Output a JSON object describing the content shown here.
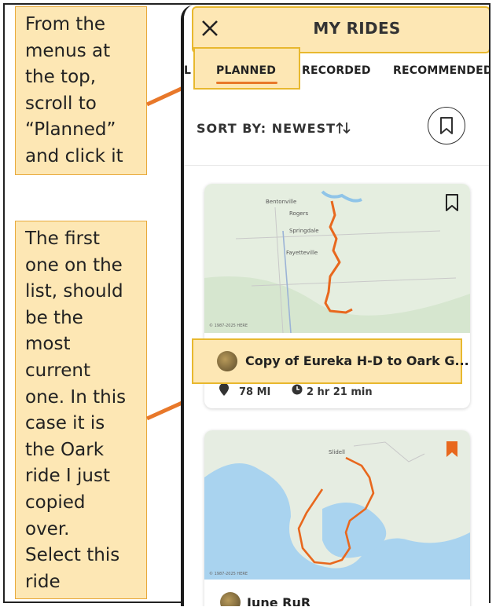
{
  "callouts": {
    "top": "From the\nmenus at\nthe top,\nscroll to\n“Planned”\nand click it",
    "bottom": "The first\none on the\nlist, should\nbe the\nmost\ncurrent\none. In this\ncase it is\nthe Oark\nride I just\ncopied\nover.\nSelect this\nride"
  },
  "header": {
    "title": "MY RIDES",
    "close_icon": "close-icon"
  },
  "tabs": [
    {
      "label": "L"
    },
    {
      "label": "PLANNED",
      "active": true
    },
    {
      "label": "RECORDED"
    },
    {
      "label": "RECOMMENDED"
    }
  ],
  "sort": {
    "label": "SORT BY: NEWEST",
    "icon": "sort-arrows-icon",
    "bookmark_icon": "bookmark-icon"
  },
  "rides": [
    {
      "name": "Copy of Eureka H-D to Oark G...",
      "distance": "78 MI",
      "duration": "2 hr 21 min",
      "map_labels": [
        "Bentonville",
        "Rogers",
        "Springdale",
        "Fayetteville"
      ],
      "map_attribution": "© 1987-2025 HERE",
      "bookmarked": false
    },
    {
      "name": "June RuR",
      "map_labels": [
        "Slidell"
      ],
      "map_attribution": "© 1987-2025 HERE",
      "bookmarked": true
    }
  ],
  "colors": {
    "accent": "#e8782a",
    "highlight_fill": "#fde7b4",
    "highlight_border": "#e8b82e",
    "route": "#e8681e"
  }
}
